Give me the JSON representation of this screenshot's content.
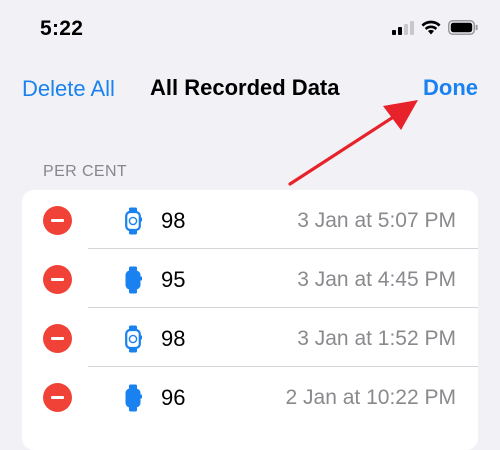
{
  "status_bar": {
    "time": "5:22",
    "icons": [
      "cellular-signal-icon",
      "wifi-icon",
      "battery-icon"
    ]
  },
  "nav": {
    "left_label": "Delete All",
    "title": "All Recorded Data",
    "right_label": "Done"
  },
  "section": {
    "header": "PER CENT"
  },
  "records": [
    {
      "icon": "watch-outline-icon",
      "value": "98",
      "timestamp": "3 Jan at 5:07 PM"
    },
    {
      "icon": "watch-filled-icon",
      "value": "95",
      "timestamp": "3 Jan at 4:45 PM"
    },
    {
      "icon": "watch-outline-icon",
      "value": "98",
      "timestamp": "3 Jan at 1:52 PM"
    },
    {
      "icon": "watch-filled-icon",
      "value": "96",
      "timestamp": "2 Jan at 10:22 PM"
    }
  ],
  "annotation": {
    "type": "arrow",
    "color": "#e8222a",
    "points_to": "Done"
  },
  "colors": {
    "accent": "#1a82f0",
    "delete": "#f14238",
    "background": "#f2f2f6"
  }
}
